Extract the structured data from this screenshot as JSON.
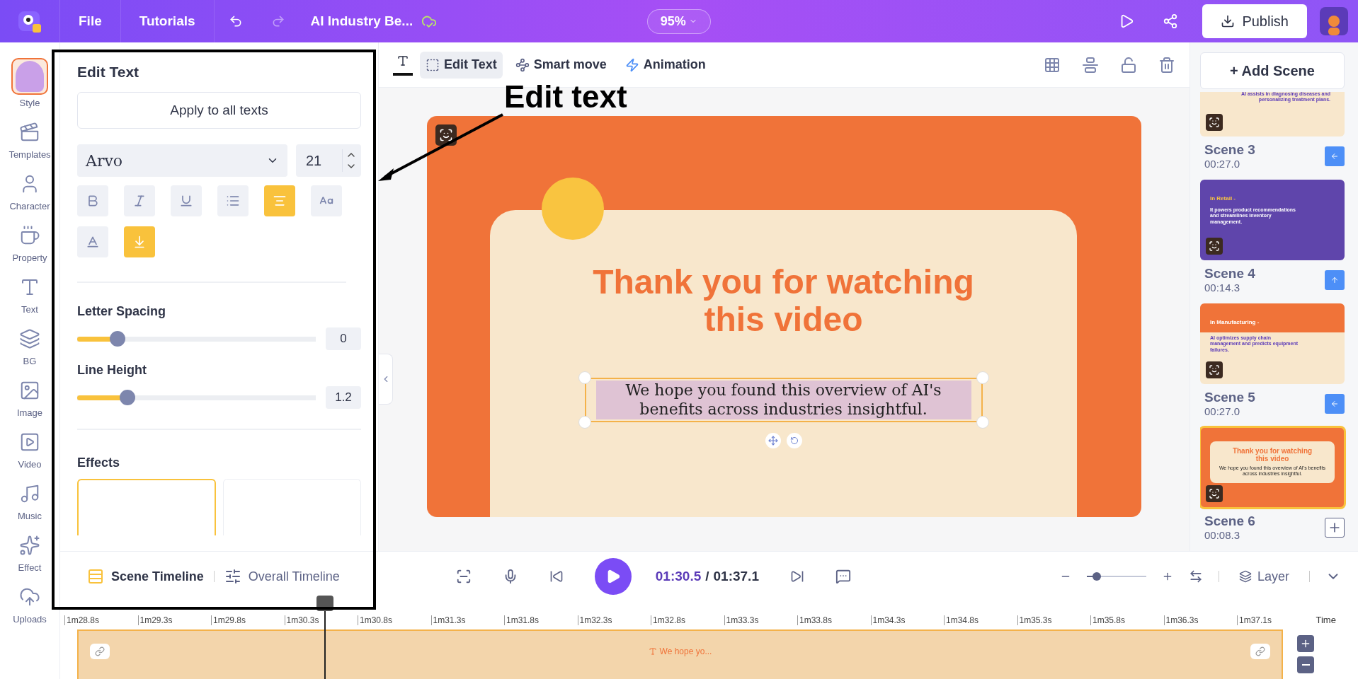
{
  "top_bar": {
    "menu": [
      {
        "label": "File"
      },
      {
        "label": "Tutorials"
      }
    ],
    "project_title": "AI Industry Be...",
    "zoom": "95%",
    "publish": "Publish"
  },
  "rail": [
    {
      "label": "Style",
      "selected": true
    },
    {
      "label": "Templates",
      "selected": false
    },
    {
      "label": "Character",
      "selected": false
    },
    {
      "label": "Property",
      "selected": false
    },
    {
      "label": "Text",
      "selected": false
    },
    {
      "label": "BG",
      "selected": false
    },
    {
      "label": "Image",
      "selected": false
    },
    {
      "label": "Video",
      "selected": false
    },
    {
      "label": "Music",
      "selected": false
    },
    {
      "label": "Effect",
      "selected": false
    },
    {
      "label": "Uploads",
      "selected": false
    }
  ],
  "edit_panel": {
    "title": "Edit Text",
    "apply_all": "Apply to all texts",
    "font": "Arvo",
    "font_size": "21",
    "format_buttons": [
      {
        "selected": false
      },
      {
        "selected": false
      },
      {
        "selected": false
      },
      {
        "selected": false
      },
      {
        "selected": true
      },
      {
        "selected": false
      },
      {
        "selected": false
      },
      {
        "selected": true
      }
    ],
    "letter_spacing": {
      "label": "Letter Spacing",
      "level": 0.17,
      "value": "0"
    },
    "line_height": {
      "label": "Line Height",
      "level": 0.21,
      "value": "1.2"
    },
    "effects": {
      "title": "Effects",
      "cards": [
        {
          "selected": true
        },
        {
          "selected": false
        }
      ]
    }
  },
  "canvas_toolbar": {
    "tools": [
      {
        "label": "Edit Text",
        "selected": true
      },
      {
        "label": "Smart move",
        "selected": false
      },
      {
        "label": "Animation",
        "selected": false
      }
    ]
  },
  "slide": {
    "title": "Thank you for watching this video",
    "body": "We hope you found this overview of AI's benefits across industries insightful."
  },
  "scenes": {
    "add_button": "+ Add Scene",
    "items": [
      {
        "kind": "cream",
        "name": "Scene 3",
        "duration": "00:27.0",
        "selected": false,
        "action": {
          "kind": "move-left"
        },
        "text": "AI assists in diagnosing diseases and personalizing treatment plans."
      },
      {
        "kind": "purple",
        "name": "Scene 4",
        "duration": "00:14.3",
        "selected": false,
        "action": {
          "kind": "move-up"
        },
        "heading": "In Retail -",
        "text": "It powers product recommendations and streamlines inventory management."
      },
      {
        "kind": "split",
        "name": "Scene 5",
        "duration": "00:27.0",
        "selected": false,
        "action": {
          "kind": "move-left"
        },
        "heading": "In Manufacturing -",
        "text": "AI optimizes supply chain management and predicts equipment failures."
      },
      {
        "kind": "ending",
        "name": "Scene 6",
        "duration": "00:08.3",
        "selected": true,
        "action": {
          "kind": "add"
        },
        "heading": "Thank you for watching this video",
        "text": "We hope you found this overview of AI's benefits across industries insightful."
      }
    ]
  },
  "bottom_bar": {
    "tabs": [
      {
        "label": "Scene Timeline",
        "selected": true
      },
      {
        "label": "Overall Timeline",
        "selected": false
      }
    ],
    "current_time": "01:30.5",
    "separator": "/",
    "total_time": "01:37.1",
    "zoom": {
      "level": 0.17
    },
    "layer": "Layer"
  },
  "timeline": {
    "ticks": [
      "1m28.8s",
      "1m29.3s",
      "1m29.8s",
      "1m30.3s",
      "1m30.8s",
      "1m31.3s",
      "1m31.8s",
      "1m32.3s",
      "1m32.8s",
      "1m33.3s",
      "1m33.8s",
      "1m34.3s",
      "1m34.8s",
      "1m35.3s",
      "1m35.8s",
      "1m36.3s",
      "1m37.1s"
    ],
    "time_label": "Time",
    "clip": "We hope yo..."
  },
  "annotation": {
    "label": "Edit text"
  }
}
